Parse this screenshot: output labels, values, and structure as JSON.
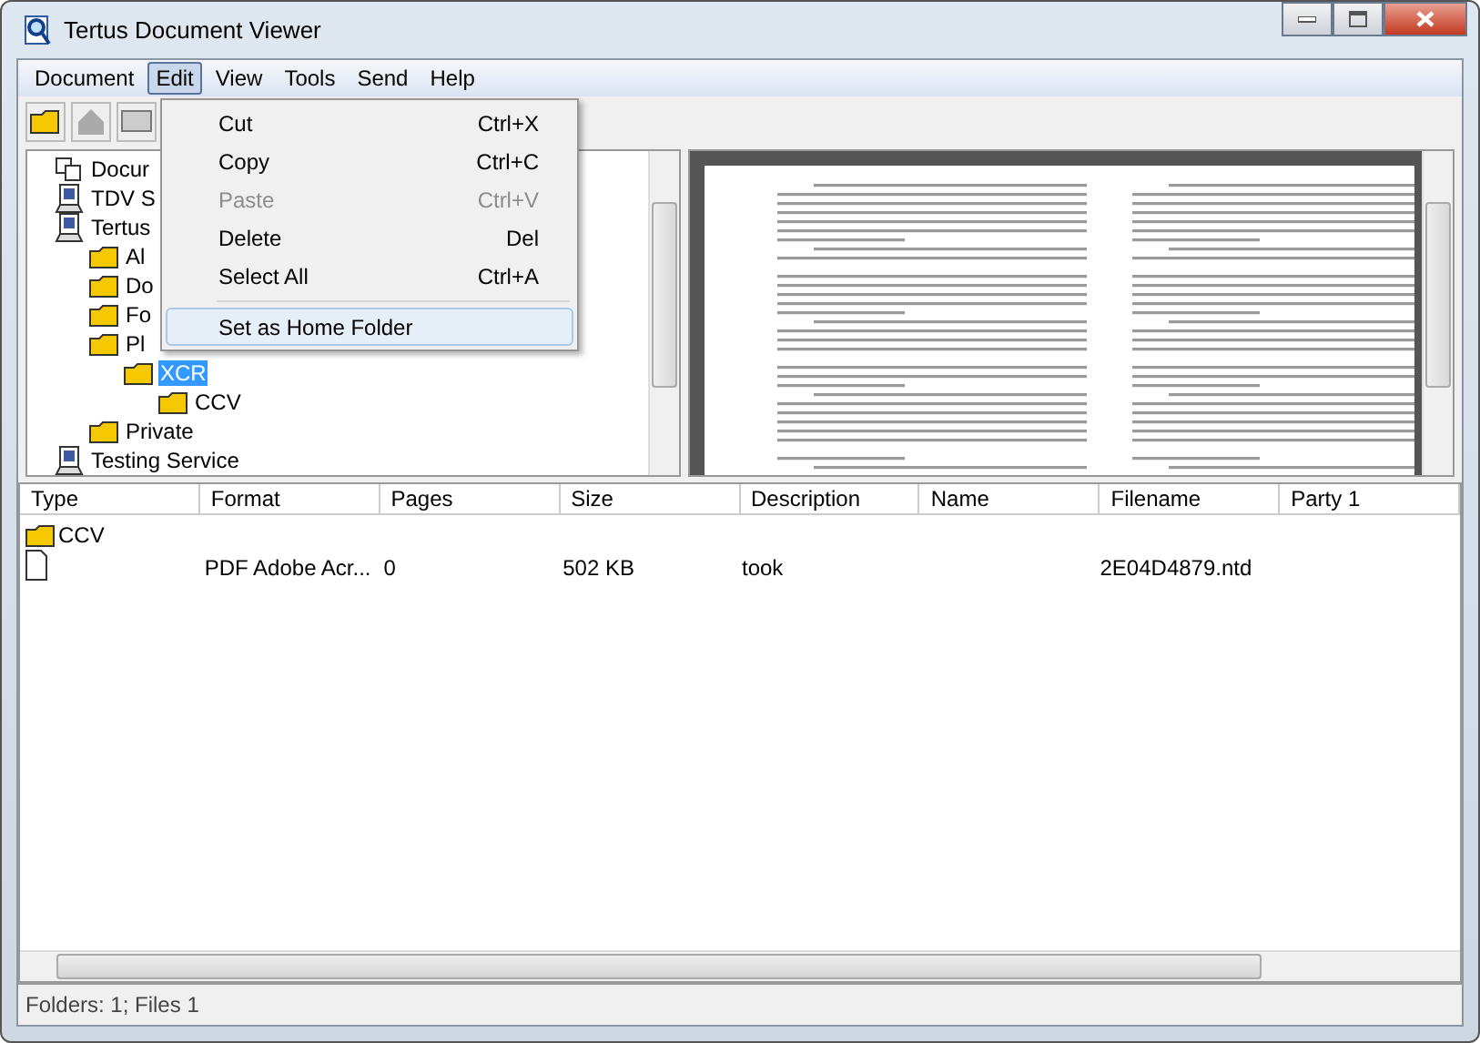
{
  "window": {
    "title": "Tertus Document Viewer"
  },
  "menu_bar": [
    {
      "label": "Document",
      "selected": false
    },
    {
      "label": "Edit",
      "selected": true
    },
    {
      "label": "View",
      "selected": false
    },
    {
      "label": "Tools",
      "selected": false
    },
    {
      "label": "Send",
      "selected": false
    },
    {
      "label": "Help",
      "selected": false
    }
  ],
  "tree": [
    {
      "label": "Docur",
      "kind": "documents",
      "selected": false
    },
    {
      "label": "TDV S",
      "kind": "server",
      "selected": false
    },
    {
      "label": "Tertus",
      "kind": "server",
      "selected": false,
      "children": [
        {
          "label": "Al",
          "kind": "folder",
          "selected": false
        },
        {
          "label": "Do",
          "kind": "folder",
          "selected": false
        },
        {
          "label": "Fo",
          "kind": "folder",
          "selected": false
        },
        {
          "label": "Pl",
          "kind": "folder",
          "selected": false,
          "children": [
            {
              "label": "XCR",
              "kind": "folder",
              "selected": true,
              "children": [
                {
                  "label": "CCV",
                  "kind": "folder",
                  "selected": false
                }
              ]
            }
          ]
        },
        {
          "label": "Private",
          "kind": "folder",
          "selected": false
        }
      ]
    },
    {
      "label": "Testing Service",
      "kind": "server",
      "selected": false
    }
  ],
  "edit_menu": [
    {
      "label": "Cut",
      "shortcut": "Ctrl+X",
      "disabled": false,
      "highlighted": false,
      "separator_before": false
    },
    {
      "label": "Copy",
      "shortcut": "Ctrl+C",
      "disabled": false,
      "highlighted": false,
      "separator_before": false
    },
    {
      "label": "Paste",
      "shortcut": "Ctrl+V",
      "disabled": true,
      "highlighted": false,
      "separator_before": false
    },
    {
      "label": "Delete",
      "shortcut": "Del",
      "disabled": false,
      "highlighted": false,
      "separator_before": false
    },
    {
      "label": "Select All",
      "shortcut": "Ctrl+A",
      "disabled": false,
      "highlighted": false,
      "separator_before": false
    },
    {
      "label": "Set as Home Folder",
      "disabled": false,
      "highlighted": true,
      "separator_before": true
    }
  ],
  "file_list": {
    "columns": [
      "Type",
      "Format",
      "Pages",
      "Size",
      "Description",
      "Name",
      "Filename",
      "Party 1"
    ],
    "rows": [
      {
        "kind": "folder",
        "type": "CCV"
      },
      {
        "kind": "file",
        "format": "PDF Adobe Acr...",
        "pages": "0",
        "size": "502 KB",
        "description": "took",
        "filename": "2E04D4879.ntd"
      }
    ]
  },
  "status_bar": "Folders: 1; Files 1"
}
